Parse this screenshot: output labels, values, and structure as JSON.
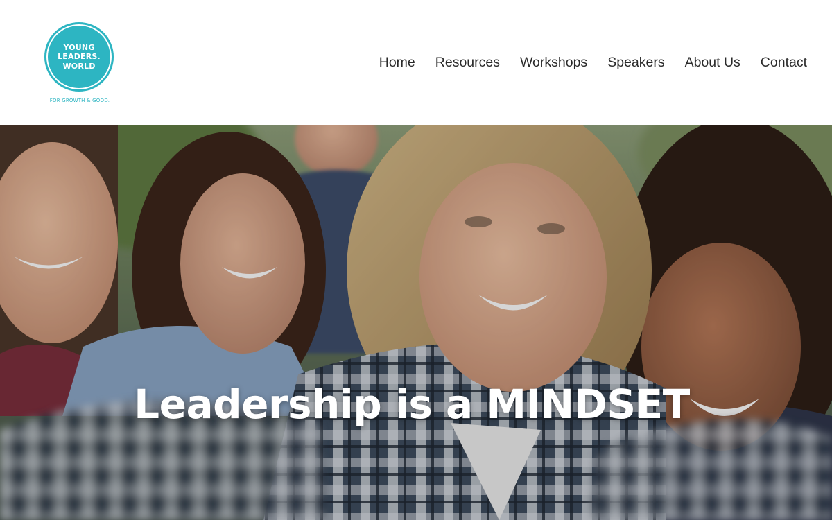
{
  "logo": {
    "lines": [
      "YOUNG",
      "LEADERS.",
      "WORLD"
    ],
    "tagline": "FOR GROWTH & GOOD.",
    "color": "#2db5c2"
  },
  "nav": {
    "items": [
      {
        "label": "Home",
        "active": true
      },
      {
        "label": "Resources",
        "active": false
      },
      {
        "label": "Workshops",
        "active": false
      },
      {
        "label": "Speakers",
        "active": false
      },
      {
        "label": "About Us",
        "active": false
      },
      {
        "label": "Contact",
        "active": false
      }
    ]
  },
  "hero": {
    "title": "Leadership is a MINDSET",
    "image_subject": "group-of-smiling-young-people-selfie"
  }
}
